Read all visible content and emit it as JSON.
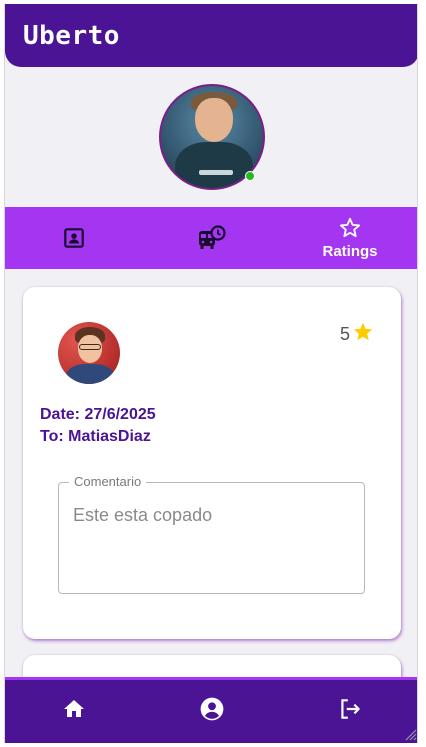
{
  "app": {
    "title": "Uberto"
  },
  "profile": {
    "status": "online",
    "status_color": "#22bb22"
  },
  "tabs": [
    {
      "icon": "contact-card-icon",
      "label": ""
    },
    {
      "icon": "bus-schedule-icon",
      "label": ""
    },
    {
      "icon": "star-outline-icon",
      "label": "Ratings"
    }
  ],
  "review": {
    "rating_value": "5",
    "rating_icon": "star-icon",
    "date_line": "Date: 27/6/2025",
    "to_line": "To: MatiasDiaz",
    "comment_label": "Comentario",
    "comment_value": "Este esta copado"
  },
  "bottom_nav": [
    {
      "icon": "home-icon"
    },
    {
      "icon": "account-circle-icon"
    },
    {
      "icon": "logout-icon"
    }
  ],
  "colors": {
    "primary": "#4a1494",
    "accent": "#a436f2",
    "background": "#f1f0f5",
    "star": "#ffcc00"
  }
}
